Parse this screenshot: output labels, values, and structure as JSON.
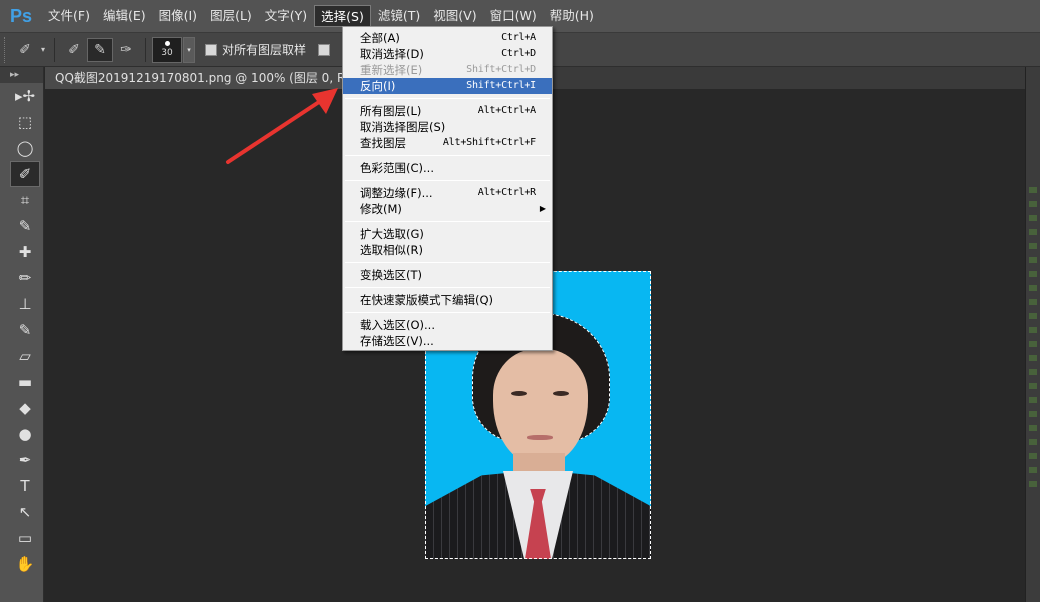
{
  "app": {
    "logo": "Ps",
    "menu": [
      "文件(F)",
      "编辑(E)",
      "图像(I)",
      "图层(L)",
      "文字(Y)",
      "选择(S)",
      "滤镜(T)",
      "视图(V)",
      "窗口(W)",
      "帮助(H)"
    ],
    "active_menu_index": 5
  },
  "options_bar": {
    "brush_size": "30",
    "sample_all_layers": "对所有图层取样"
  },
  "document_tab": {
    "title": "QQ截图20191219170801.png @ 100% (图层 0, RG"
  },
  "select_menu": {
    "groups": [
      [
        {
          "label": "全部(A)",
          "shortcut": "Ctrl+A",
          "state": "normal"
        },
        {
          "label": "取消选择(D)",
          "shortcut": "Ctrl+D",
          "state": "normal"
        },
        {
          "label": "重新选择(E)",
          "shortcut": "Shift+Ctrl+D",
          "state": "disabled"
        },
        {
          "label": "反向(I)",
          "shortcut": "Shift+Ctrl+I",
          "state": "highlighted"
        }
      ],
      [
        {
          "label": "所有图层(L)",
          "shortcut": "Alt+Ctrl+A",
          "state": "normal"
        },
        {
          "label": "取消选择图层(S)",
          "shortcut": "",
          "state": "normal"
        },
        {
          "label": "查找图层",
          "shortcut": "Alt+Shift+Ctrl+F",
          "state": "normal"
        }
      ],
      [
        {
          "label": "色彩范围(C)...",
          "shortcut": "",
          "state": "normal"
        }
      ],
      [
        {
          "label": "调整边缘(F)...",
          "shortcut": "Alt+Ctrl+R",
          "state": "normal"
        },
        {
          "label": "修改(M)",
          "shortcut": "",
          "state": "submenu"
        }
      ],
      [
        {
          "label": "扩大选取(G)",
          "shortcut": "",
          "state": "normal"
        },
        {
          "label": "选取相似(R)",
          "shortcut": "",
          "state": "normal"
        }
      ],
      [
        {
          "label": "变换选区(T)",
          "shortcut": "",
          "state": "normal"
        }
      ],
      [
        {
          "label": "在快速蒙版模式下编辑(Q)",
          "shortcut": "",
          "state": "normal"
        }
      ],
      [
        {
          "label": "载入选区(O)...",
          "shortcut": "",
          "state": "normal"
        },
        {
          "label": "存储选区(V)...",
          "shortcut": "",
          "state": "normal"
        }
      ]
    ]
  },
  "tools": [
    "move-tool",
    "marquee-tool",
    "lasso-tool",
    "quick-selection-tool",
    "crop-tool",
    "eyedropper-tool",
    "healing-brush-tool",
    "brush-tool",
    "clone-stamp-tool",
    "history-brush-tool",
    "eraser-tool",
    "gradient-tool",
    "blur-tool",
    "dodge-tool",
    "pen-tool",
    "type-tool",
    "path-selection-tool",
    "rectangle-tool",
    "hand-tool"
  ],
  "colors": {
    "menu_highlight": "#3a6fbd",
    "photo_background": "#08b7f2",
    "arrow": "#e8342f"
  }
}
